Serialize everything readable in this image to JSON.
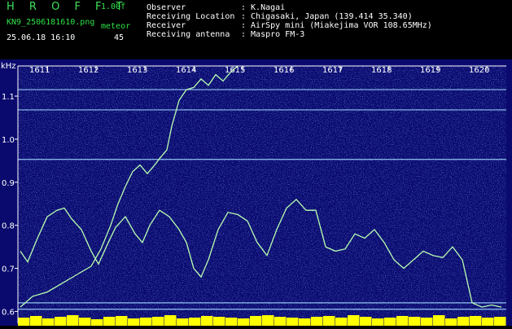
{
  "header": {
    "app_title": "H R O F F T",
    "version": "1.00f",
    "filename": "KN9_2506181610.png",
    "meteor_label": "meteor",
    "datetime": "25.06.18 16:10",
    "meteor_count": "45",
    "info": [
      {
        "key": "Observer",
        "value": ": K.Nagai"
      },
      {
        "key": "Receiving Location",
        "value": ": Chigasaki, Japan (139.414 35.340)"
      },
      {
        "key": "Receiver",
        "value": ": AirSpy mini (Miakejima VOR 108.65MHz)"
      },
      {
        "key": "Receiving antenna",
        "value": ": Maspro FM-3"
      }
    ]
  },
  "colors": {
    "background": "#0a0a6e",
    "trace": "#b8ffb0",
    "axis": "#ffffff",
    "meteor_bar": "#ffff00"
  },
  "chart_data": {
    "type": "spectrogram",
    "ylabel": "kHz",
    "y_ticks": [
      "1.1",
      "1.0",
      "0.9",
      "0.8",
      "0.7",
      "0.6"
    ],
    "y_tick_values": [
      1.1,
      1.0,
      0.9,
      0.8,
      0.7,
      0.6
    ],
    "ylim": [
      0.58,
      1.17
    ],
    "x_ticks": [
      "1611",
      "1612",
      "1613",
      "1614",
      "1615",
      "1616",
      "1617",
      "1618",
      "1619",
      "1620"
    ],
    "x_tick_values": [
      1611,
      1612,
      1613,
      1614,
      1615,
      1616,
      1617,
      1618,
      1619,
      1620
    ],
    "xlim": [
      1610.4,
      1620.4
    ],
    "carrier_lines_khz": [
      1.115,
      1.068,
      0.953,
      0.62,
      0.605
    ],
    "trace_rising": {
      "x": [
        1610.45,
        1610.7,
        1611.0,
        1611.3,
        1611.6,
        1611.9,
        1612.1,
        1612.3,
        1612.45,
        1612.6,
        1612.75,
        1612.9,
        1613.05,
        1613.2,
        1613.3,
        1613.45,
        1613.55,
        1613.7,
        1613.85,
        1614.0,
        1614.15,
        1614.3,
        1614.45,
        1614.6,
        1614.75,
        1614.9
      ],
      "y": [
        0.61,
        0.635,
        0.645,
        0.665,
        0.685,
        0.705,
        0.745,
        0.8,
        0.85,
        0.89,
        0.925,
        0.94,
        0.92,
        0.94,
        0.955,
        0.975,
        1.03,
        1.09,
        1.115,
        1.12,
        1.14,
        1.125,
        1.15,
        1.135,
        1.155,
        1.17
      ]
    },
    "trace_wandering": {
      "x": [
        1610.45,
        1610.6,
        1610.8,
        1611.0,
        1611.2,
        1611.35,
        1611.5,
        1611.7,
        1611.9,
        1612.05,
        1612.25,
        1612.4,
        1612.6,
        1612.8,
        1612.95,
        1613.1,
        1613.3,
        1613.5,
        1613.7,
        1613.85,
        1614.0,
        1614.15,
        1614.3,
        1614.5,
        1614.7,
        1614.9,
        1615.1,
        1615.3,
        1615.5,
        1615.7,
        1615.9,
        1616.1,
        1616.3,
        1616.5,
        1616.7,
        1616.9,
        1617.1,
        1617.3,
        1617.5,
        1617.7,
        1617.9,
        1618.1,
        1618.3,
        1618.5,
        1618.7,
        1618.9,
        1619.1,
        1619.3,
        1619.5,
        1619.7,
        1619.9,
        1620.1,
        1620.3
      ],
      "y": [
        0.74,
        0.715,
        0.77,
        0.82,
        0.835,
        0.84,
        0.815,
        0.79,
        0.74,
        0.71,
        0.76,
        0.795,
        0.82,
        0.78,
        0.76,
        0.8,
        0.835,
        0.82,
        0.79,
        0.76,
        0.7,
        0.68,
        0.72,
        0.79,
        0.83,
        0.825,
        0.81,
        0.76,
        0.73,
        0.79,
        0.84,
        0.86,
        0.835,
        0.835,
        0.75,
        0.74,
        0.745,
        0.78,
        0.77,
        0.79,
        0.76,
        0.72,
        0.7,
        0.72,
        0.74,
        0.73,
        0.725,
        0.75,
        0.72,
        0.62,
        0.61,
        0.615,
        0.61
      ]
    },
    "meteor_activity": [
      0.6,
      0.8,
      0.5,
      0.7,
      0.9,
      0.6,
      0.4,
      0.7,
      0.8,
      0.5,
      0.6,
      0.7,
      0.9,
      0.5,
      0.6,
      0.8,
      0.7,
      0.6,
      0.5,
      0.8,
      0.9,
      0.7,
      0.6,
      0.5,
      0.7,
      0.8,
      0.6,
      0.9,
      0.7,
      0.5,
      0.6,
      0.8,
      0.7,
      0.6,
      0.9,
      0.5,
      0.7,
      0.8,
      0.6,
      0.7
    ]
  }
}
